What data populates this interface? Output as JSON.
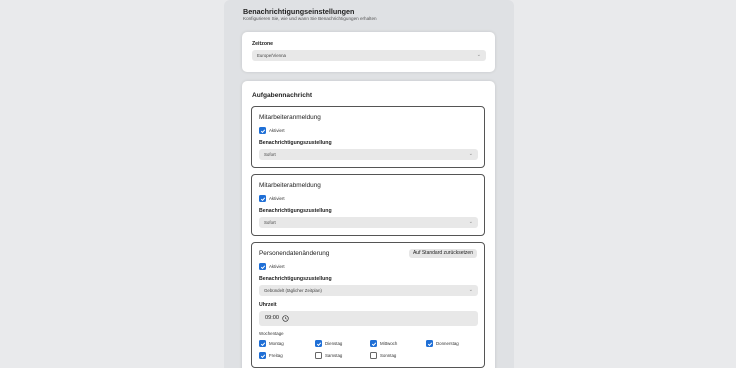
{
  "page": {
    "title": "Benachrichtigungseinstellungen",
    "subtitle": "Konfigurieren Sie, wie und wann Sie Benachrichtigungen erhalten"
  },
  "timezone": {
    "label": "Zeitzone",
    "value": "Europe/Vienna"
  },
  "tasks": {
    "title": "Aufgabennachricht",
    "sections": [
      {
        "title": "Mitarbeiteranmeldung",
        "enabled_label": "Aktiviert",
        "enabled": true,
        "delivery_label": "Benachrichtigungszustellung",
        "delivery_value": "Sofort"
      },
      {
        "title": "Mitarbeiterabmeldung",
        "enabled_label": "Aktiviert",
        "enabled": true,
        "delivery_label": "Benachrichtigungszustellung",
        "delivery_value": "Sofort"
      },
      {
        "title": "Personendatenänderung",
        "reset_label": "Auf Standard zurücksetzen",
        "enabled_label": "Aktiviert",
        "enabled": true,
        "delivery_label": "Benachrichtigungszustellung",
        "delivery_value": "Gebündelt (täglicher Zeitplan)",
        "time_label": "Uhrzeit",
        "time_value": "09:00",
        "weekdays_label": "Wochentage",
        "weekdays": [
          {
            "label": "Montag",
            "checked": true
          },
          {
            "label": "Dienstag",
            "checked": true
          },
          {
            "label": "Mittwoch",
            "checked": true
          },
          {
            "label": "Donnerstag",
            "checked": true
          },
          {
            "label": "Freitag",
            "checked": true
          },
          {
            "label": "Samstag",
            "checked": false
          },
          {
            "label": "Sonntag",
            "checked": false
          }
        ]
      }
    ]
  },
  "colors": {
    "accent": "#1f6fd6",
    "background": "#e9eaec",
    "panel": "#dfe1e4"
  }
}
